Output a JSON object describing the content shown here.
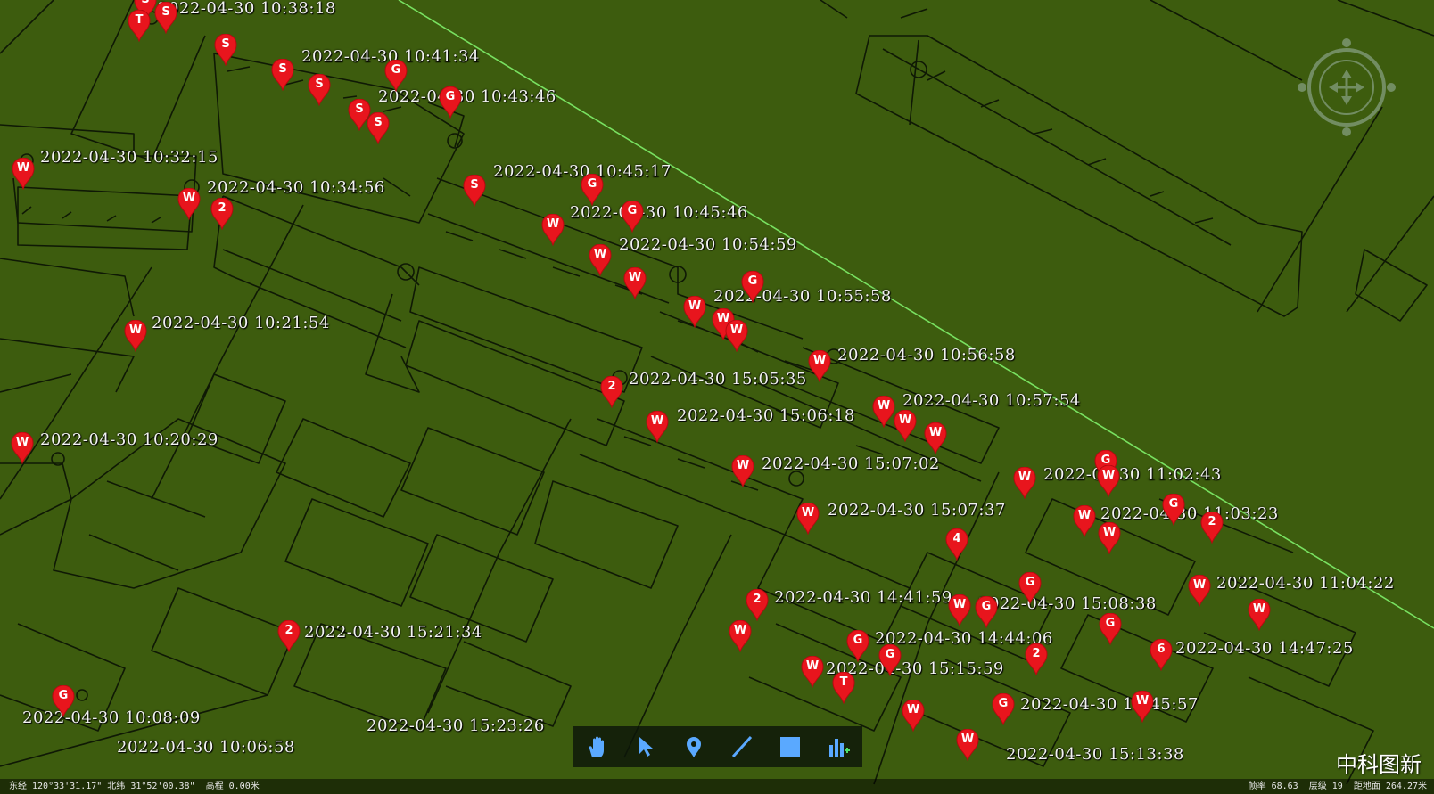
{
  "map": {
    "brand": "中科图新",
    "status_left": "东经 120°33'31.17\" 北纬 31°52'00.38\"  高程 0.00米",
    "status_right": "帧率 68.63  层级 19  距地面 264.27米",
    "colors": {
      "background": "#3d5c0e",
      "outline": "#101a06",
      "marker": "#e8151d",
      "track": "#7ff06a"
    },
    "timestamps": [
      "2022-04-30 10:38:18",
      "2022-04-30 10:41:34",
      "2022-04-30 10:43:46",
      "2022-04-30 10:32:15",
      "2022-04-30 10:34:56",
      "2022-04-30 10:45:17",
      "2022-04-30 10:45:46",
      "2022-04-30 10:54:59",
      "2022-04-30 10:55:58",
      "2022-04-30 10:21:54",
      "2022-04-30 10:56:58",
      "2022-04-30 15:05:35",
      "2022-04-30 10:57:54",
      "2022-04-30 15:06:18",
      "2022-04-30 10:20:29",
      "2022-04-30 15:07:02",
      "2022-04-30 11:02:43",
      "2022-04-30 15:07:37",
      "2022-04-30 11:03:23",
      "2022-04-30 11:04:22",
      "2022-04-30 14:41:59",
      "2022-04-30 15:08:38",
      "2022-04-30 15:21:34",
      "2022-04-30 14:44:06",
      "2022-04-30 14:47:25",
      "2022-04-30 15:15:59",
      "2022-04-30 14:45:57",
      "2022-04-30 10:08:09",
      "2022-04-30 15:23:26",
      "2022-04-30 10:06:58",
      "2022-04-30 15:13:38"
    ],
    "markers": [
      "S",
      "S",
      "T",
      "S",
      "S",
      "S",
      "G",
      "G",
      "S",
      "S",
      "W",
      "W",
      "2",
      "S",
      "G",
      "G",
      "W",
      "W",
      "W",
      "G",
      "W",
      "W",
      "W",
      "W",
      "W",
      "2",
      "W",
      "W",
      "W",
      "W",
      "W",
      "W",
      "G",
      "W",
      "W",
      "W",
      "G",
      "4",
      "W",
      "2",
      "W",
      "W",
      "W",
      "G",
      "W",
      "G",
      "G",
      "G",
      "G",
      "W",
      "T",
      "2",
      "6",
      "W",
      "2",
      "W",
      "G",
      "W",
      "W",
      "G",
      "2"
    ],
    "tools": [
      "pan-tool",
      "select-tool",
      "marker-tool",
      "line-tool",
      "polygon-tool",
      "chart-tool"
    ]
  }
}
